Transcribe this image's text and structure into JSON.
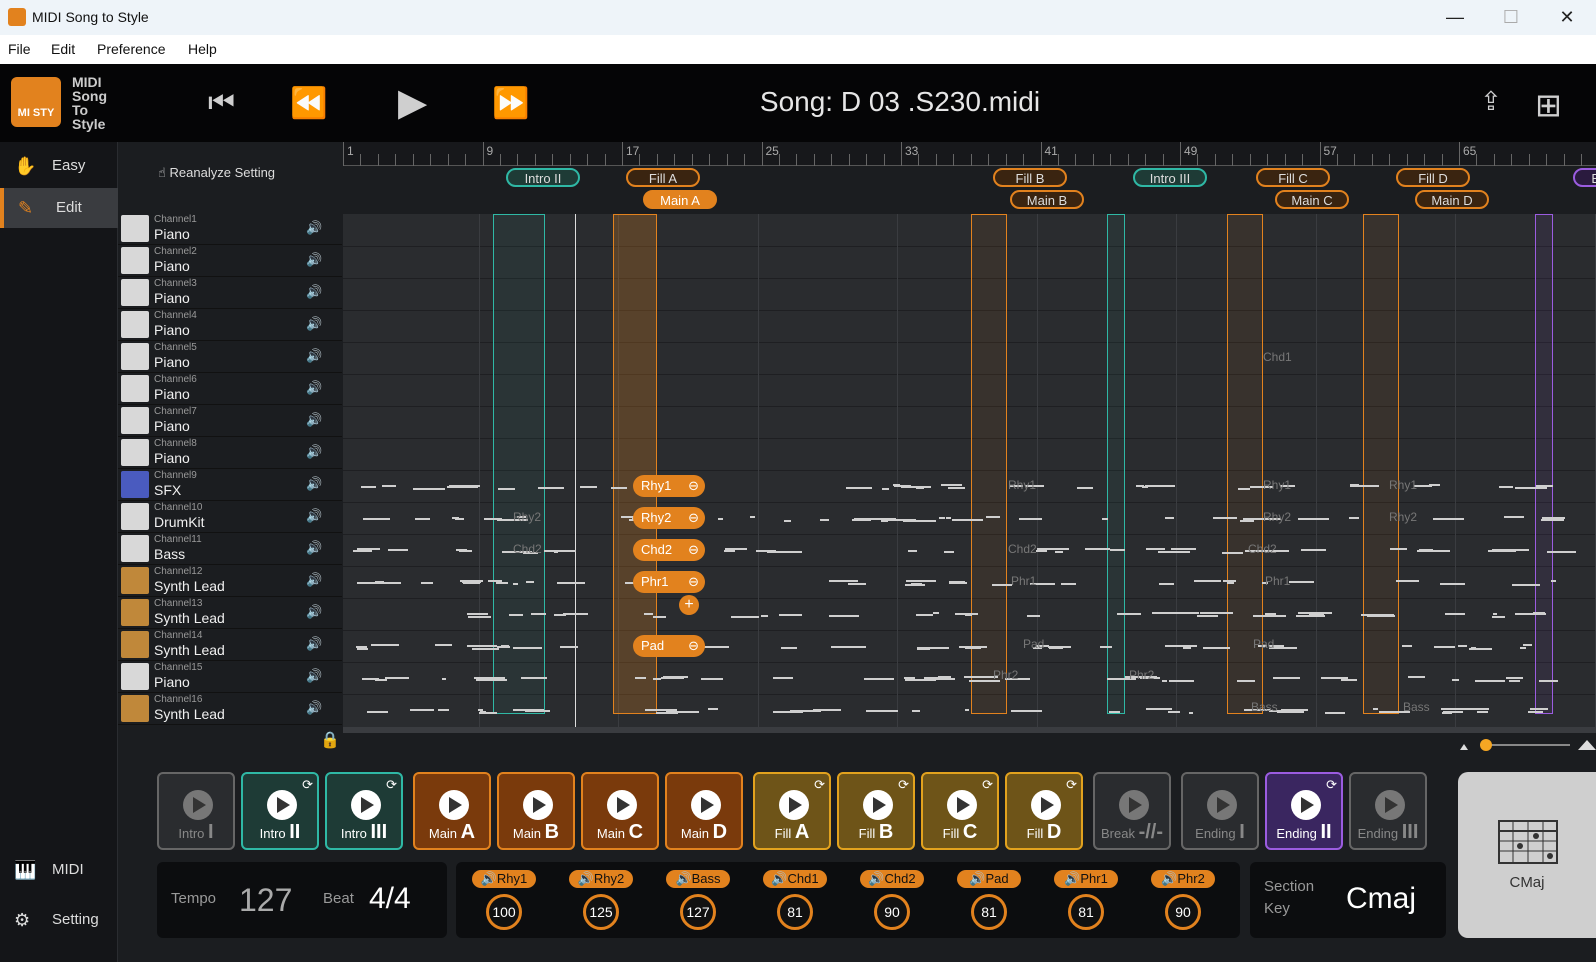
{
  "window": {
    "title": "MIDI Song to Style",
    "minimize": "—",
    "maximize": "☐",
    "close": "✕"
  },
  "menu": [
    "File",
    "Edit",
    "Preference",
    "Help"
  ],
  "logo": {
    "badge": "MI STY",
    "lines": [
      "MIDI",
      "Song",
      "To",
      "Style"
    ]
  },
  "transport": {
    "to_start": "⏮",
    "rewind": "⏪",
    "play": "▶",
    "forward": "⏩"
  },
  "song": {
    "title": "Song: D  03 .S230.midi"
  },
  "header_icons": {
    "export": "⇪",
    "add": "⊞"
  },
  "nav": [
    {
      "label": "Easy",
      "icon": "hand-icon"
    },
    {
      "label": "Edit",
      "icon": "edit-icon"
    }
  ],
  "nav_bottom": [
    {
      "label": "MIDI",
      "icon": "midi-icon"
    },
    {
      "label": "Setting",
      "icon": "gear-icon"
    }
  ],
  "reanalyze": "Reanalyze Setting",
  "channels": [
    {
      "ch": "Channel1",
      "inst": "Piano"
    },
    {
      "ch": "Channel2",
      "inst": "Piano"
    },
    {
      "ch": "Channel3",
      "inst": "Piano"
    },
    {
      "ch": "Channel4",
      "inst": "Piano"
    },
    {
      "ch": "Channel5",
      "inst": "Piano"
    },
    {
      "ch": "Channel6",
      "inst": "Piano"
    },
    {
      "ch": "Channel7",
      "inst": "Piano"
    },
    {
      "ch": "Channel8",
      "inst": "Piano"
    },
    {
      "ch": "Channel9",
      "inst": "SFX"
    },
    {
      "ch": "Channel10",
      "inst": "DrumKit"
    },
    {
      "ch": "Channel11",
      "inst": "Bass"
    },
    {
      "ch": "Channel12",
      "inst": "Synth Lead"
    },
    {
      "ch": "Channel13",
      "inst": "Synth Lead"
    },
    {
      "ch": "Channel14",
      "inst": "Synth Lead"
    },
    {
      "ch": "Channel15",
      "inst": "Piano"
    },
    {
      "ch": "Channel16",
      "inst": "Synth Lead"
    }
  ],
  "ruler": [
    "1",
    "9",
    "17",
    "25",
    "33",
    "41",
    "49",
    "57",
    "65"
  ],
  "markers_top": [
    "Intro II",
    "Fill A",
    "Fill B",
    "Intro III",
    "Fill C",
    "Fill D",
    "End"
  ],
  "markers_bottom": [
    "Main A",
    "Main B",
    "Main C",
    "Main D"
  ],
  "track_pills": [
    "Rhy1",
    "Rhy2",
    "Chd2",
    "Phr1",
    "Pad"
  ],
  "track_labels": [
    "Rhy2",
    "Chd2",
    "Rhy1",
    "Chd2",
    "Phr1",
    "Pad",
    "Phr2",
    "Phr2",
    "Chd1",
    "Rhy1",
    "Rhy2",
    "Chd2",
    "Phr1",
    "Pad",
    "Bass",
    "Rhy1",
    "Rhy2",
    "Bass"
  ],
  "sections": [
    {
      "label": "Intro",
      "num": "I",
      "color": "#2a2c2f",
      "border": "#666"
    },
    {
      "label": "Intro",
      "num": "II",
      "color": "#1e3b36",
      "border": "#2fb8a5",
      "loop": true
    },
    {
      "label": "Intro",
      "num": "III",
      "color": "#1e3b36",
      "border": "#2fb8a5",
      "loop": true
    },
    {
      "label": "Main",
      "num": "A",
      "color": "#7a3a0c",
      "border": "#e2821e"
    },
    {
      "label": "Main",
      "num": "B",
      "color": "#7a3a0c",
      "border": "#e2821e"
    },
    {
      "label": "Main",
      "num": "C",
      "color": "#7a3a0c",
      "border": "#e2821e"
    },
    {
      "label": "Main",
      "num": "D",
      "color": "#7a3a0c",
      "border": "#e2821e"
    },
    {
      "label": "Fill",
      "num": "A",
      "color": "#6e5418",
      "border": "#e2a21e",
      "loop": true
    },
    {
      "label": "Fill",
      "num": "B",
      "color": "#6e5418",
      "border": "#e2a21e",
      "loop": true
    },
    {
      "label": "Fill",
      "num": "C",
      "color": "#6e5418",
      "border": "#e2a21e",
      "loop": true
    },
    {
      "label": "Fill",
      "num": "D",
      "color": "#6e5418",
      "border": "#e2a21e",
      "loop": true
    },
    {
      "label": "Break",
      "num": "-//-",
      "color": "#2a2c2f",
      "border": "#666"
    },
    {
      "label": "Ending",
      "num": "I",
      "color": "#2a2c2f",
      "border": "#666"
    },
    {
      "label": "Ending",
      "num": "II",
      "color": "#3a2660",
      "border": "#9b5ce0",
      "loop": true
    },
    {
      "label": "Ending",
      "num": "III",
      "color": "#2a2c2f",
      "border": "#666"
    }
  ],
  "tempo": {
    "tempo_label": "Tempo",
    "tempo": "127",
    "beat_label": "Beat",
    "beat": "4/4"
  },
  "mixer": [
    {
      "name": "Rhy1",
      "value": "100"
    },
    {
      "name": "Rhy2",
      "value": "125"
    },
    {
      "name": "Bass",
      "value": "127"
    },
    {
      "name": "Chd1",
      "value": "81"
    },
    {
      "name": "Chd2",
      "value": "90"
    },
    {
      "name": "Pad",
      "value": "81"
    },
    {
      "name": "Phr1",
      "value": "81"
    },
    {
      "name": "Phr2",
      "value": "90"
    }
  ],
  "key": {
    "section_label": "Section",
    "key_label": "Key",
    "value": "Cmaj"
  },
  "chord": {
    "label": "CMaj"
  },
  "colors": {
    "accent": "#e2821e",
    "teal": "#2fb8a5",
    "purple": "#9b5ce0"
  }
}
